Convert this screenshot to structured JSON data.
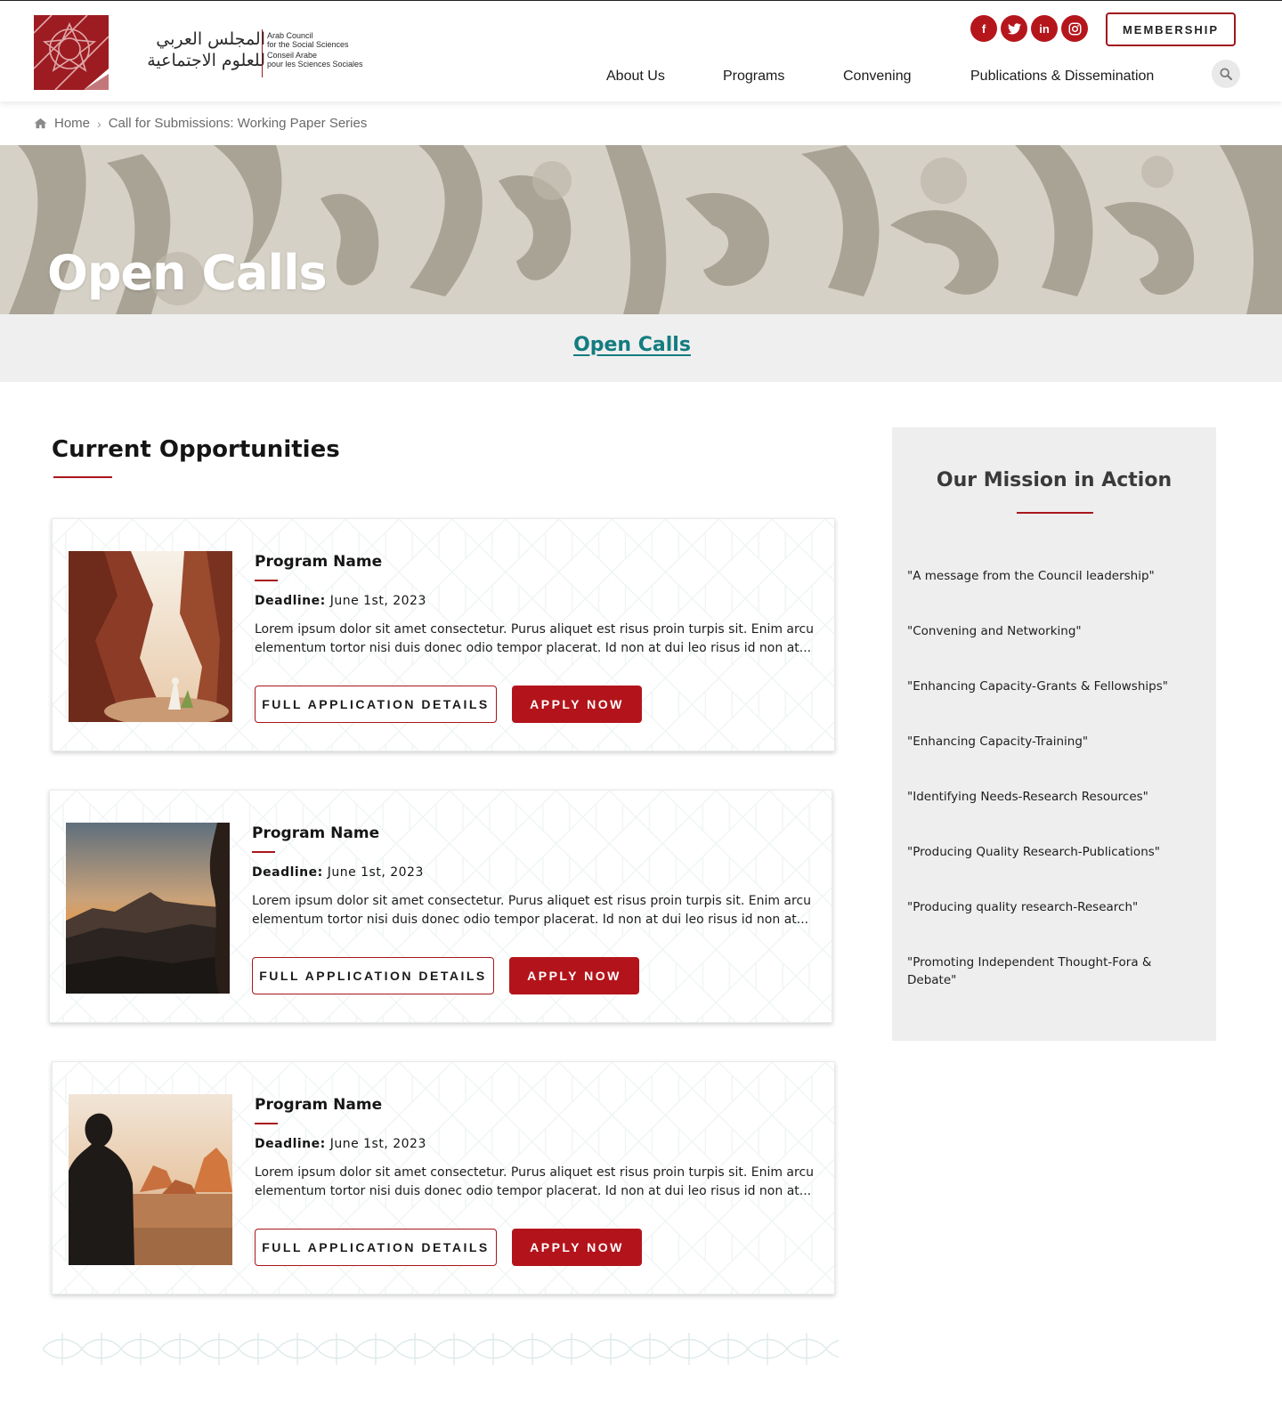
{
  "header": {
    "logo": {
      "arabic_line1": "المجلس العربي",
      "arabic_line2": "للعلوم الاجتماعية",
      "en_line1": "Arab Council",
      "en_line2": "for the Social Sciences",
      "fr_line1": "Conseil Arabe",
      "fr_line2": "pour les Sciences Sociales"
    },
    "social": [
      {
        "icon": "facebook-icon",
        "glyph": "f"
      },
      {
        "icon": "twitter-icon",
        "glyph": "t"
      },
      {
        "icon": "linkedin-icon",
        "glyph": "in"
      },
      {
        "icon": "instagram-icon",
        "glyph": "◎"
      }
    ],
    "membership_label": "MEMBERSHIP",
    "nav": [
      "About Us",
      "Programs",
      "Convening",
      "Publications & Dissemination"
    ],
    "search_icon": "search-icon"
  },
  "breadcrumb": {
    "home": "Home",
    "separator": "›",
    "current": "Call for Submissions: Working Paper Series"
  },
  "hero": {
    "title": "Open Calls"
  },
  "subbar": {
    "link": "Open Calls"
  },
  "main": {
    "section_title": "Current Opportunities",
    "cards": [
      {
        "name": "Program Name",
        "deadline_label": "Deadline:",
        "deadline_value": "June 1st, 2023",
        "desc_line1": "Lorem ipsum dolor sit amet consectetur. Purus aliquet est risus proin turpis sit. Enim arcu",
        "desc_line2": "elementum tortor nisi duis donec odio tempor placerat. Id non at dui leo risus id non at...",
        "details_label": "FULL APPLICATION DETAILS",
        "apply_label": "APPLY NOW"
      },
      {
        "name": "Program Name",
        "deadline_label": "Deadline:",
        "deadline_value": "June 1st, 2023",
        "desc_line1": "Lorem ipsum dolor sit amet consectetur. Purus aliquet est risus proin turpis sit. Enim arcu",
        "desc_line2": "elementum tortor nisi duis donec odio tempor placerat. Id non at dui leo risus id non at...",
        "details_label": "FULL APPLICATION DETAILS",
        "apply_label": "APPLY NOW"
      },
      {
        "name": "Program Name",
        "deadline_label": "Deadline:",
        "deadline_value": "June 1st, 2023",
        "desc_line1": "Lorem ipsum dolor sit amet consectetur. Purus aliquet est risus proin turpis sit. Enim arcu",
        "desc_line2": "elementum tortor nisi duis donec odio tempor placerat. Id non at dui leo risus id non at...",
        "details_label": "FULL APPLICATION DETAILS",
        "apply_label": "APPLY NOW"
      }
    ]
  },
  "sidebar": {
    "title": "Our Mission in Action",
    "items": [
      "\"A message from the Council leadership\"",
      "\"Convening and Networking\"",
      "\"Enhancing Capacity-Grants & Fellowships\"",
      "\"Enhancing Capacity-Training\"",
      "\"Identifying Needs-Research Resources\"",
      "\"Producing Quality Research-Publications\"",
      "\"Producing quality research-Research\"",
      "\"Promoting Independent Thought-Fora & Debate\""
    ]
  },
  "colors": {
    "brand_red": "#b3141b",
    "teal_link": "#137c80",
    "sidebar_bg": "#eeeeee",
    "subbar_bg": "#efefef"
  }
}
